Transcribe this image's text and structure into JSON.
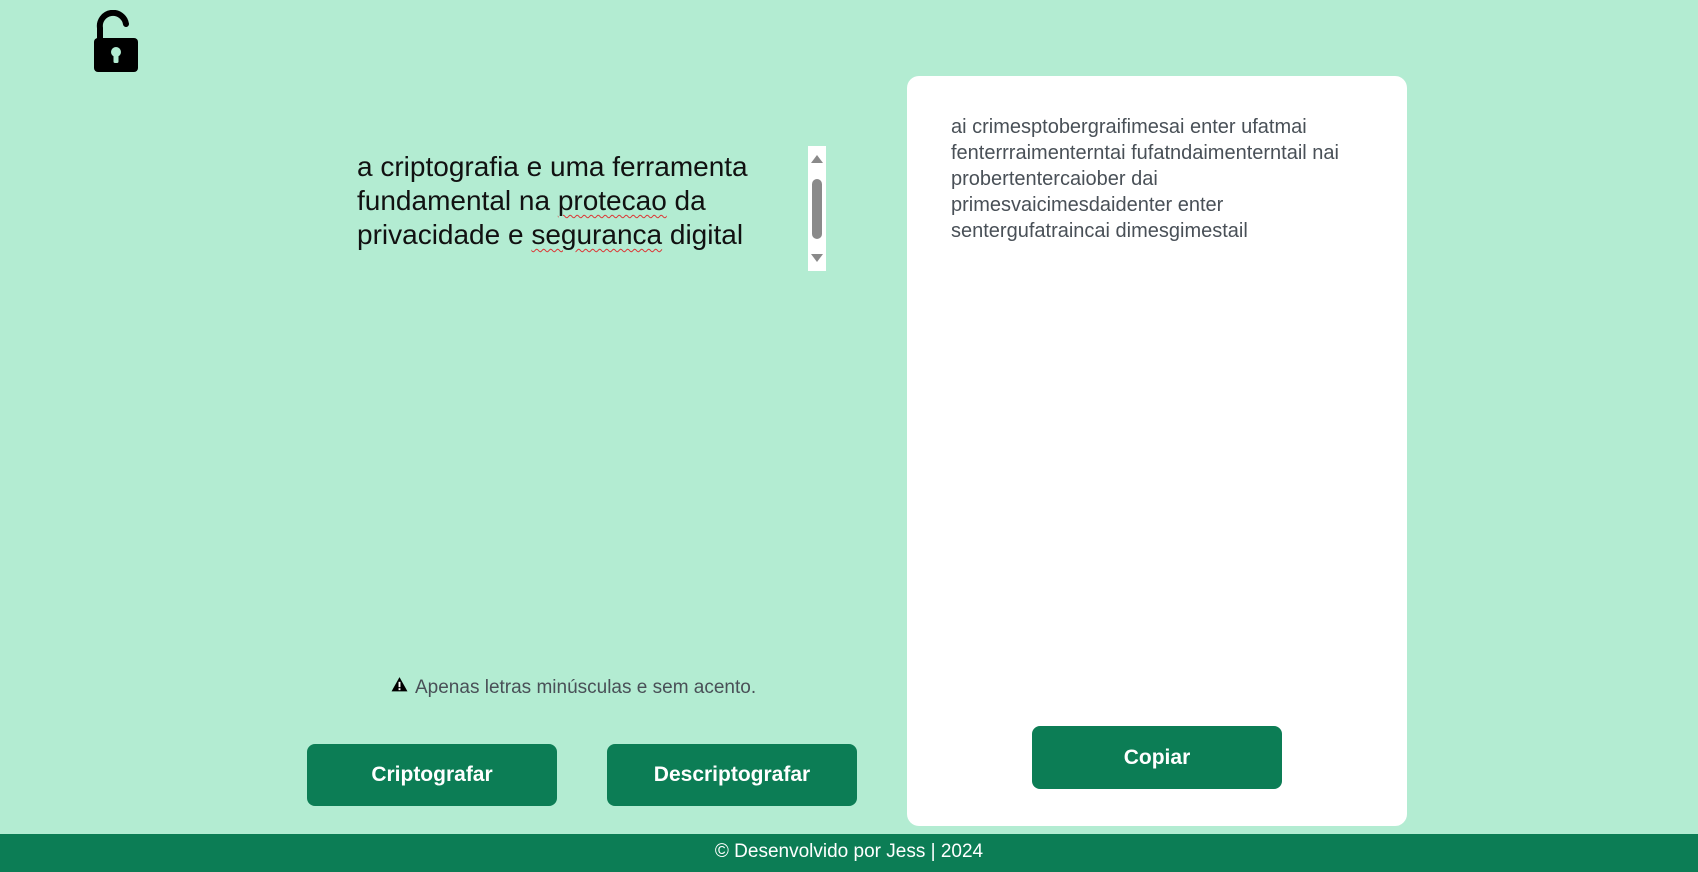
{
  "logo": {
    "icon": "lock-open-icon"
  },
  "input": {
    "line1": "a criptografia e uma ferramenta",
    "line2_a": "fundamental na ",
    "line2_b": "protecao",
    "line2_c": " da",
    "line3_a": "privacidade e ",
    "line3_b": "seguranca",
    "line3_c": " digital"
  },
  "hint": {
    "icon": "warning-icon",
    "text": "Apenas letras minúsculas e sem acento."
  },
  "buttons": {
    "encrypt": "Criptografar",
    "decrypt": "Descriptografar",
    "copy": "Copiar"
  },
  "output": {
    "text": "ai crimesptobergraifimesai enter ufatmai fenterrraimenterntai fufatndaimenterntail nai probertentercaiober dai primesvaicimesdaidenter enter sentergufatraincai dimesgimestail"
  },
  "footer": {
    "text": "© Desenvolvido por Jess | 2024"
  },
  "colors": {
    "background": "#b3ecd2",
    "primary": "#0c7d55",
    "panel": "#ffffff"
  }
}
